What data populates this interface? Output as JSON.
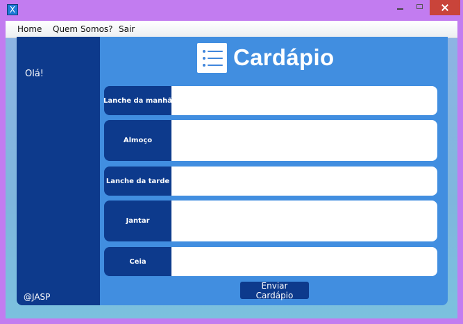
{
  "window": {
    "icon_glyph": "X",
    "controls": [
      "minimize-icon",
      "maximize-icon",
      "close-icon"
    ]
  },
  "menu": {
    "items": [
      {
        "label": "Home"
      },
      {
        "label": "Quem Somos?"
      },
      {
        "label": "Sair"
      }
    ]
  },
  "sidebar": {
    "greeting": "Olá!",
    "footer": "@JASP"
  },
  "header": {
    "icon": "list-icon",
    "title": "Cardápio"
  },
  "form": {
    "meals": [
      {
        "label": "Lanche da manhã",
        "value": ""
      },
      {
        "label": "Almoço",
        "value": ""
      },
      {
        "label": "Lanche da tarde",
        "value": ""
      },
      {
        "label": "Jantar",
        "value": ""
      },
      {
        "label": "Ceia",
        "value": ""
      }
    ],
    "submit_label": "Enviar Cardápio"
  },
  "colors": {
    "window_frame": "#c27cf0",
    "sidebar": "#0d3a8c",
    "panel": "#418ee0",
    "close_button": "#c9443a",
    "field_background": "#ffffff"
  }
}
